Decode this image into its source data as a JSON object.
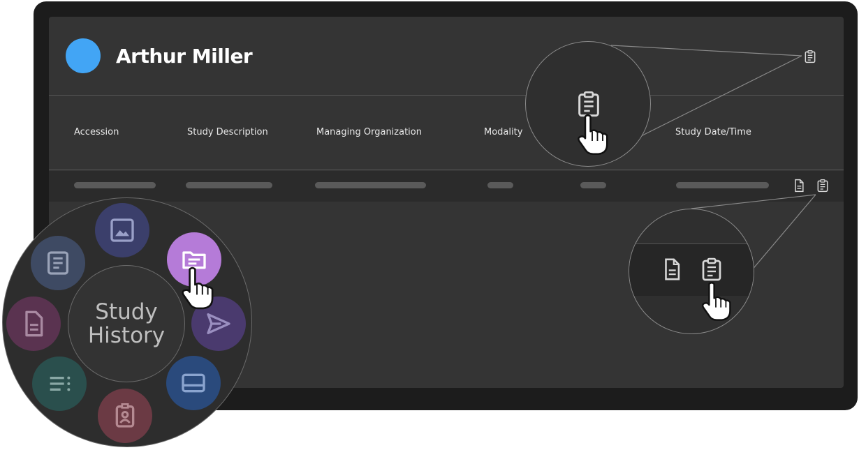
{
  "patient": {
    "name": "Arthur Miller",
    "avatar_color": "#42a5f5"
  },
  "table": {
    "columns": [
      "Accession",
      "Study Description",
      "Managing Organization",
      "Modality",
      "Study Date/Time"
    ]
  },
  "radial_menu": {
    "center_label_line1": "Study",
    "center_label_line2": "History",
    "items": [
      {
        "icon": "image-icon",
        "color": "#3b3f6b"
      },
      {
        "icon": "folder-icon",
        "color": "#b57bd8",
        "active": true
      },
      {
        "icon": "send-icon",
        "color": "#4a3a6e"
      },
      {
        "icon": "panel-icon",
        "color": "#2a4a7c"
      },
      {
        "icon": "id-badge-icon",
        "color": "#6b3a44"
      },
      {
        "icon": "list-icon",
        "color": "#2a4f4d"
      },
      {
        "icon": "document-icon",
        "color": "#5a3350"
      },
      {
        "icon": "text-doc-icon",
        "color": "#3e4a63"
      }
    ]
  },
  "row_actions": [
    "document-icon",
    "clipboard-icon"
  ],
  "colors": {
    "screen": "#343434",
    "device": "#1c1c1c",
    "accent_purple": "#b57bd8"
  }
}
